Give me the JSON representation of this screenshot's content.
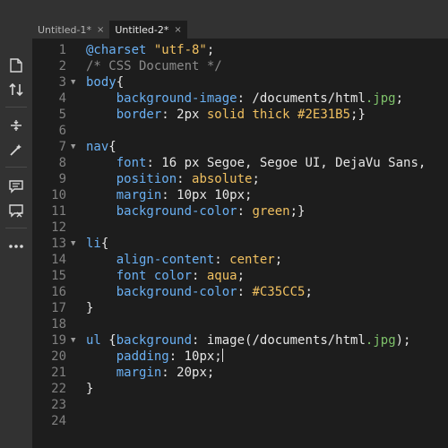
{
  "tabs": [
    {
      "label": "Untitled-1*",
      "close": "×"
    },
    {
      "label": "Untitled-2*",
      "close": "×"
    }
  ],
  "toolbar": {
    "icons": [
      "file-icon",
      "sort-icon",
      "expand-icon",
      "wand-icon",
      "comment-icon",
      "comment-remove-icon",
      "more-icon"
    ]
  },
  "colors": {
    "selector": "#87ceeb",
    "property": "#6fa8dc",
    "value": "#ffd700",
    "number": "#e6e6e6",
    "punct": "#e6e6e6",
    "comment": "#a0a0a0",
    "string": "#ffd700",
    "green": "#90ee90"
  },
  "lines": [
    [
      [
        "#6ab0f3",
        "@charset "
      ],
      [
        "#f0c060",
        "\"utf-8\""
      ],
      [
        "#e6e6e6",
        ";"
      ]
    ],
    [
      [
        "#8a8a8a",
        "/* CSS Document */"
      ]
    ],
    [
      [
        "#6ab0f3",
        "body"
      ],
      [
        "#e6e6e6",
        "{"
      ]
    ],
    [
      [
        "#e6e6e6",
        "    "
      ],
      [
        "#6ab0f3",
        "background-image"
      ],
      [
        "#e6e6e6",
        ": /documents/html"
      ],
      [
        "#7ec26a",
        ".jpg"
      ],
      [
        "#e6e6e6",
        ";"
      ]
    ],
    [
      [
        "#e6e6e6",
        "    "
      ],
      [
        "#6ab0f3",
        "border"
      ],
      [
        "#e6e6e6",
        ": 2px "
      ],
      [
        "#f0c060",
        "solid thick"
      ],
      [
        "#e6e6e6",
        " "
      ],
      [
        "#f0c060",
        "#2E31B5"
      ],
      [
        "#e6e6e6",
        ";}"
      ]
    ],
    [],
    [
      [
        "#6ab0f3",
        "nav"
      ],
      [
        "#e6e6e6",
        "{"
      ]
    ],
    [
      [
        "#e6e6e6",
        "    "
      ],
      [
        "#6ab0f3",
        "font"
      ],
      [
        "#e6e6e6",
        ": 16 px Segoe, Segoe UI, DejaVu Sans,"
      ]
    ],
    [
      [
        "#e6e6e6",
        "    "
      ],
      [
        "#6ab0f3",
        "position"
      ],
      [
        "#e6e6e6",
        ": "
      ],
      [
        "#f0c060",
        "absolute"
      ],
      [
        "#e6e6e6",
        ";"
      ]
    ],
    [
      [
        "#e6e6e6",
        "    "
      ],
      [
        "#6ab0f3",
        "margin"
      ],
      [
        "#e6e6e6",
        ": 10px 10px;"
      ]
    ],
    [
      [
        "#e6e6e6",
        "    "
      ],
      [
        "#6ab0f3",
        "background-color"
      ],
      [
        "#e6e6e6",
        ": "
      ],
      [
        "#f0c060",
        "green"
      ],
      [
        "#e6e6e6",
        ";}"
      ]
    ],
    [],
    [
      [
        "#6ab0f3",
        "li"
      ],
      [
        "#e6e6e6",
        "{"
      ]
    ],
    [
      [
        "#e6e6e6",
        "    "
      ],
      [
        "#6ab0f3",
        "align-content"
      ],
      [
        "#e6e6e6",
        ": "
      ],
      [
        "#f0c060",
        "center"
      ],
      [
        "#e6e6e6",
        ";"
      ]
    ],
    [
      [
        "#e6e6e6",
        "    "
      ],
      [
        "#6ab0f3",
        "font color"
      ],
      [
        "#e6e6e6",
        ": "
      ],
      [
        "#f0c060",
        "aqua"
      ],
      [
        "#e6e6e6",
        ";"
      ]
    ],
    [
      [
        "#e6e6e6",
        "    "
      ],
      [
        "#6ab0f3",
        "background-color"
      ],
      [
        "#e6e6e6",
        ": "
      ],
      [
        "#f0c060",
        "#C35CC5"
      ],
      [
        "#e6e6e6",
        ";"
      ]
    ],
    [
      [
        "#e6e6e6",
        "}"
      ]
    ],
    [],
    [
      [
        "#6ab0f3",
        "ul "
      ],
      [
        "#e6e6e6",
        "{"
      ],
      [
        "#6ab0f3",
        "background"
      ],
      [
        "#e6e6e6",
        ": image(/documents/html"
      ],
      [
        "#7ec26a",
        ".jpg"
      ],
      [
        "#e6e6e6",
        ");"
      ]
    ],
    [
      [
        "#e6e6e6",
        "    "
      ],
      [
        "#6ab0f3",
        "padding"
      ],
      [
        "#e6e6e6",
        ": 10px;"
      ]
    ],
    [
      [
        "#e6e6e6",
        "    "
      ],
      [
        "#6ab0f3",
        "margin"
      ],
      [
        "#e6e6e6",
        ": 20px;"
      ]
    ],
    [
      [
        "#e6e6e6",
        "}"
      ]
    ],
    [],
    []
  ],
  "line_numbers": [
    "1",
    "2",
    "3",
    "4",
    "5",
    "6",
    "7",
    "8",
    "9",
    "10",
    "11",
    "12",
    "13",
    "14",
    "15",
    "16",
    "17",
    "18",
    "19",
    "20",
    "21",
    "22",
    "23",
    "24"
  ],
  "folds": {
    "3": "▼",
    "7": "▼",
    "13": "▼",
    "19": "▼"
  },
  "cursor_line": 20
}
